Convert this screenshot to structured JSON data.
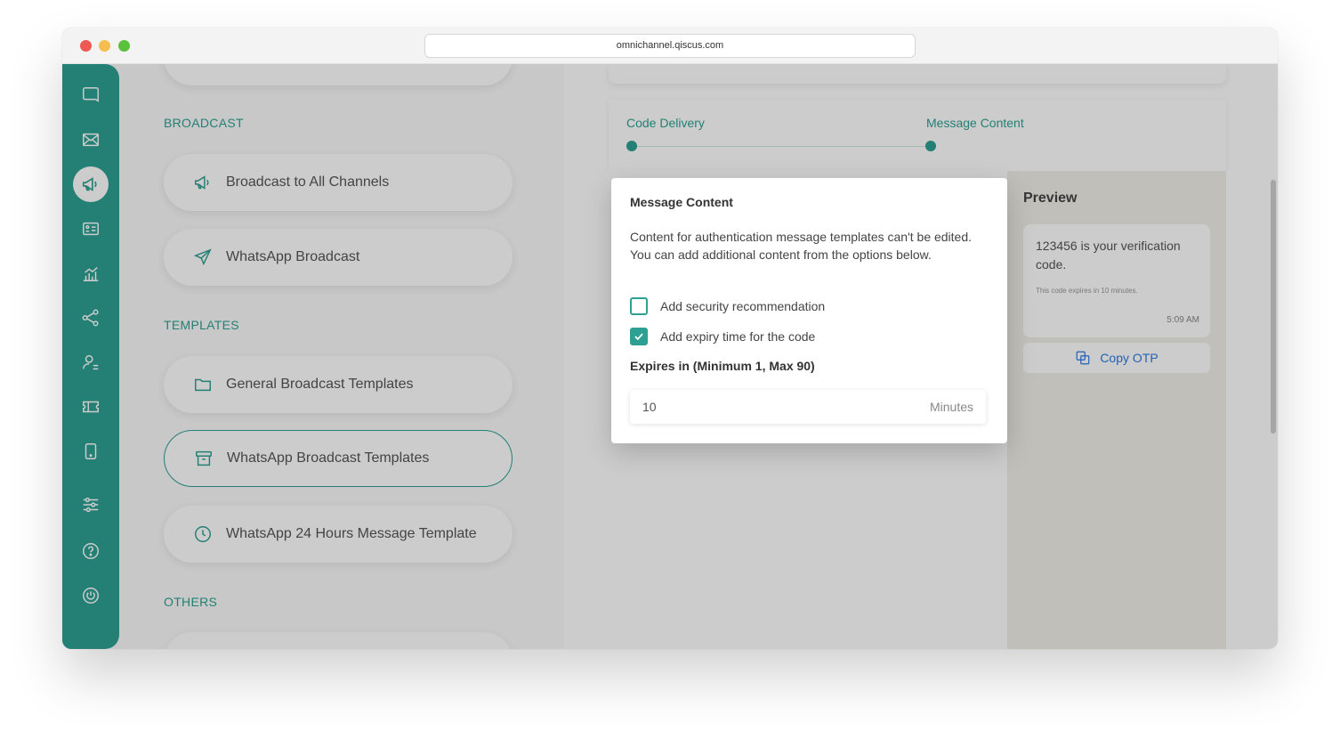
{
  "browser": {
    "url": "omnichannel.qiscus.com"
  },
  "sidebar_icons": [
    {
      "name": "chat-icon"
    },
    {
      "name": "mail-icon"
    },
    {
      "name": "megaphone-icon",
      "active": true
    },
    {
      "name": "contact-card-icon"
    },
    {
      "name": "analytics-icon"
    },
    {
      "name": "share-nodes-icon"
    },
    {
      "name": "agent-icon"
    },
    {
      "name": "ticket-icon"
    },
    {
      "name": "mobile-icon"
    },
    {
      "name": "settings-sliders-icon"
    },
    {
      "name": "help-icon"
    },
    {
      "name": "power-icon"
    }
  ],
  "menu": {
    "broadcast_label": "BROADCAST",
    "broadcast_items": [
      {
        "label": "Broadcast to All Channels",
        "icon": "megaphone-icon"
      },
      {
        "label": "WhatsApp Broadcast",
        "icon": "send-icon"
      }
    ],
    "templates_label": "TEMPLATES",
    "template_items": [
      {
        "label": "General Broadcast Templates",
        "icon": "folder-icon"
      },
      {
        "label": "WhatsApp Broadcast Templates",
        "icon": "archive-box-icon",
        "selected": true
      },
      {
        "label": "WhatsApp 24 Hours Message Template",
        "icon": "clock-icon"
      }
    ],
    "others_label": "OTHERS"
  },
  "stepper": {
    "steps": [
      "Code Delivery",
      "Message Content"
    ]
  },
  "preview": {
    "title": "Preview",
    "message": "123456 is your verification code.",
    "note": "This code expires in 10 minutes.",
    "time": "5:09 AM",
    "copy_label": "Copy OTP"
  },
  "modal": {
    "title": "Message Content",
    "description": "Content for authentication message templates can't be edited. You can add additional content from the options below.",
    "options": [
      {
        "label": "Add security recommendation",
        "checked": false
      },
      {
        "label": "Add expiry time for the code",
        "checked": true
      }
    ],
    "expires_label": "Expires in (Minimum 1, Max 90)",
    "expires_value": "10",
    "expires_unit": "Minutes"
  },
  "colors": {
    "brand": "#2ea093",
    "link": "#2a7ae4"
  }
}
